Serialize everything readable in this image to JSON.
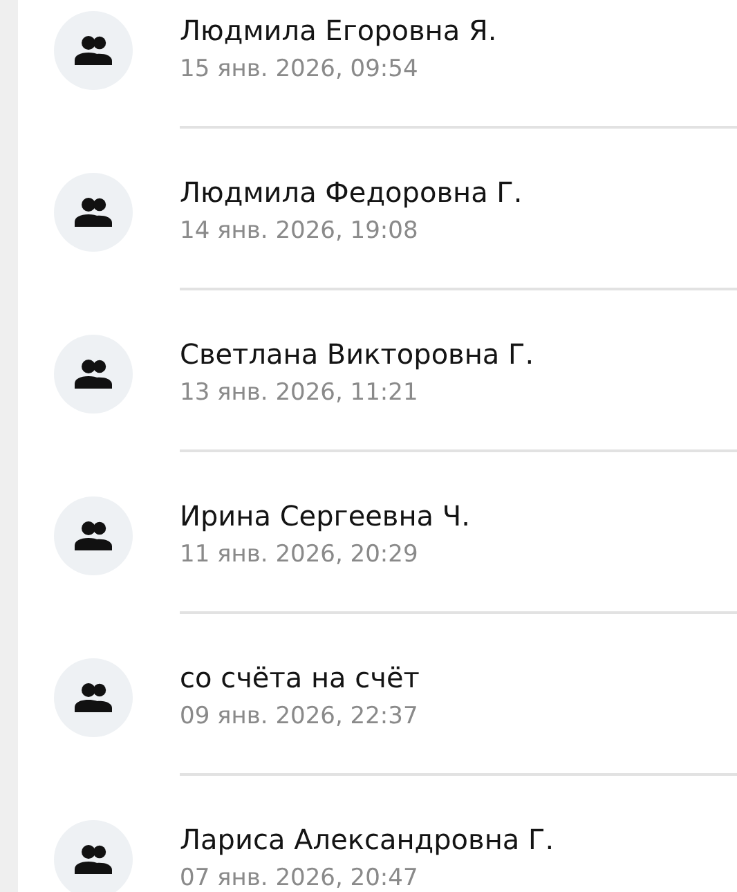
{
  "operations": [
    {
      "name": "Людмила Егоровна Я.",
      "date": "15 янв. 2026, 09:54"
    },
    {
      "name": "Людмила Федоровна Г.",
      "date": "14 янв. 2026, 19:08"
    },
    {
      "name": "Светлана Викторовна Г.",
      "date": "13 янв. 2026, 11:21"
    },
    {
      "name": "Ирина Сергеевна Ч.",
      "date": "11 янв. 2026, 20:29"
    },
    {
      "name": "со счёта на счёт",
      "date": "09 янв. 2026, 22:37"
    },
    {
      "name": "Лариса Александровна Г.",
      "date": "07 янв. 2026, 20:47"
    }
  ]
}
